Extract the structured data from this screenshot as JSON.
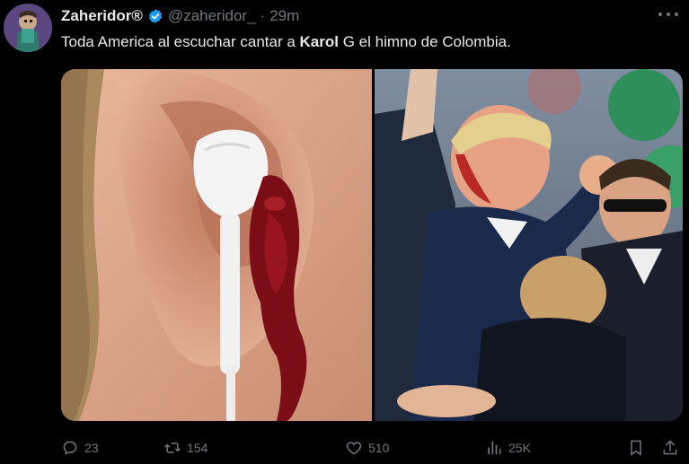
{
  "author": {
    "display_name": "Zaheridor®",
    "handle": "@zaheridor_",
    "separator": "·",
    "time": "29m",
    "verified_color": "#1d9bf0"
  },
  "tweet": {
    "text_before": "Toda America al escuchar cantar a ",
    "text_bold": "Karol",
    "text_after": " G el himno de Colombia."
  },
  "media": {
    "left_image": "ear-earphone-blood-image",
    "right_image": "raised-fist-crowd-image"
  },
  "actions": {
    "replies": "23",
    "reposts": "154",
    "likes": "510",
    "views": "25K"
  },
  "colors": {
    "background": "#000000",
    "text": "#e7e9ea",
    "muted": "#71767b",
    "accent": "#1d9bf0"
  }
}
